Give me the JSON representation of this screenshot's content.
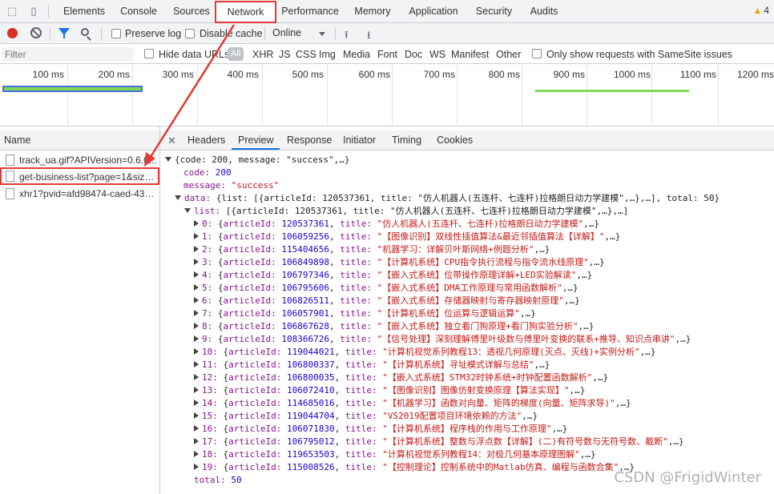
{
  "colors": {
    "highlight": "#e53935",
    "accent": "#1a73e8",
    "record": "#d93025",
    "json_key": "#881391",
    "json_number": "#1c00cf",
    "json_string": "#c41a16"
  },
  "main_tabs": [
    "Elements",
    "Console",
    "Sources",
    "Network",
    "Performance",
    "Memory",
    "Application",
    "Security",
    "Audits"
  ],
  "active_tab": "Network",
  "warning_count": "4",
  "toolbar": {
    "preserve_log": "Preserve log",
    "disable_cache": "Disable cache",
    "throttle": "Online"
  },
  "filter": {
    "placeholder": "Filter",
    "hide_data_urls": "Hide data URLs",
    "all": "All",
    "types": [
      "XHR",
      "JS",
      "CSS",
      "Img",
      "Media",
      "Font",
      "Doc",
      "WS",
      "Manifest",
      "Other"
    ],
    "samesite": "Only show requests with SameSite issues"
  },
  "timeline": {
    "ticks": [
      "100 ms",
      "200 ms",
      "300 ms",
      "400 ms",
      "500 ms",
      "600 ms",
      "700 ms",
      "800 ms",
      "900 ms",
      "1000 ms",
      "1100 ms",
      "1200 ms"
    ]
  },
  "requests": {
    "header": "Name",
    "items": [
      "track_ua.gif?APIVersion=0.6.0...",
      "get-business-list?page=1&size...",
      "xhr1?pvid=afd98474-caed-435..."
    ],
    "selected_index": 1
  },
  "detail_tabs": [
    "Headers",
    "Preview",
    "Response",
    "Initiator",
    "Timing",
    "Cookies"
  ],
  "active_detail_tab": "Preview",
  "preview": {
    "root": "{code: 200, message: \"success\",…}",
    "code_key": "code:",
    "code_val": "200",
    "message_key": "message:",
    "message_val": "\"success\"",
    "data_key": "data:",
    "data_summary": "{list: [{articleId: 120537361, title: \"仿人机器人(五连杆、七连杆)拉格朗日动力学建模\",…},…], total: 50}",
    "list_key": "list:",
    "list_summary": "[{articleId: 120537361, title: \"仿人机器人(五连杆、七连杆)拉格朗日动力学建模\",…},…]",
    "items": [
      {
        "i": "0",
        "id": "120537361",
        "title": "\"仿人机器人(五连杆、七连杆)拉格朗日动力学建模\""
      },
      {
        "i": "1",
        "id": "106059256",
        "title": "\"【图像识别】双线性插值算法&最近邻插值算法【详解】\""
      },
      {
        "i": "2",
        "id": "115404656",
        "title": "\"机器学习：详解贝叶斯网络+例题分析\""
      },
      {
        "i": "3",
        "id": "106849898",
        "title": "\"【计算机系统】CPU指令执行流程与指令流水线原理\""
      },
      {
        "i": "4",
        "id": "106797346",
        "title": "\"【嵌入式系统】位带操作原理详解+LED实验解读\""
      },
      {
        "i": "5",
        "id": "106795606",
        "title": "\"【嵌入式系统】DMA工作原理与常用函数解析\""
      },
      {
        "i": "6",
        "id": "106826511",
        "title": "\"【嵌入式系统】存储器映射与寄存器映射原理\""
      },
      {
        "i": "7",
        "id": "106057901",
        "title": "\"【计算机系统】位运算与逻辑运算\""
      },
      {
        "i": "8",
        "id": "106867628",
        "title": "\"【嵌入式系统】独立看门狗原理+看门狗实验分析\""
      },
      {
        "i": "9",
        "id": "108366726",
        "title": "\"【信号处理】深刻理解傅里叶级数与傅里叶变换的联系+推导、知识点串讲\""
      },
      {
        "i": "10",
        "id": "119044021",
        "title": "\"计算机视觉系列教程13：透视几何原理(灭点、灭线)+实例分析\""
      },
      {
        "i": "11",
        "id": "106800337",
        "title": "\"【计算机系统】寻址模式详解与总结\""
      },
      {
        "i": "12",
        "id": "106800035",
        "title": "\"【嵌入式系统】STM32时钟系统+时钟配置函数解析\""
      },
      {
        "i": "13",
        "id": "106072410",
        "title": "\"【图像识别】图像仿射变换原理【算法实现】\""
      },
      {
        "i": "14",
        "id": "114685016",
        "title": "\"【机器学习】函数对向量、矩阵的梯度(向量、矩阵求导)\""
      },
      {
        "i": "15",
        "id": "119044704",
        "title": "\"VS2019配置项目环境依赖的方法\""
      },
      {
        "i": "16",
        "id": "106071830",
        "title": "\"【计算机系统】程序栈的作用与工作原理\""
      },
      {
        "i": "17",
        "id": "106795012",
        "title": "\"【计算机系统】整数与浮点数【详解】(二)有符号数与无符号数、截断\""
      },
      {
        "i": "18",
        "id": "119653503",
        "title": "\"计算机视觉系列教程14：对极几何基本原理图解\""
      },
      {
        "i": "19",
        "id": "115008526",
        "title": "\"【控制理论】控制系统中的Matlab仿真、编程与函数合集\""
      }
    ],
    "article_key": "articleId:",
    "title_key": "title:",
    "ellipsis": ",…}",
    "total_key": "total:",
    "total_val": "50"
  },
  "watermark": "CSDN @FrigidWinter"
}
